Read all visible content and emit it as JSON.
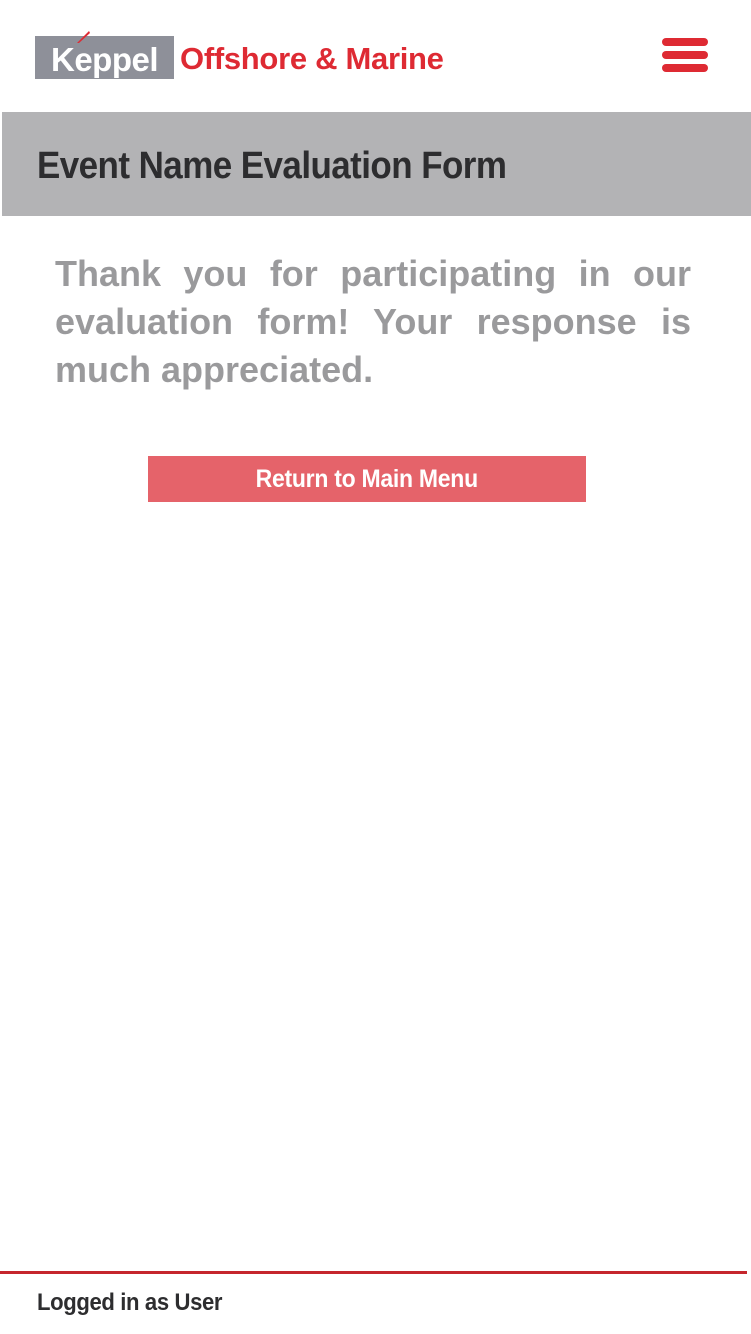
{
  "header": {
    "logo_box_text": "Keppel",
    "logo_brand_text": "Offshore & Marine",
    "menu_icon": "hamburger-menu-icon"
  },
  "main": {
    "title": "Event Name Evaluation Form",
    "message": "Thank you for participating in our evaluation form! Your response is much appreciated.",
    "return_button_label": "Return to Main Menu"
  },
  "footer": {
    "status_text": "Logged in as User"
  },
  "colors": {
    "brand_red": "#de2a33",
    "logo_gray": "#8e9099",
    "banner_gray": "#b3b3b5",
    "message_gray": "#9a9a9c",
    "button_red": "#e5636a",
    "footer_line": "#c5262d"
  }
}
